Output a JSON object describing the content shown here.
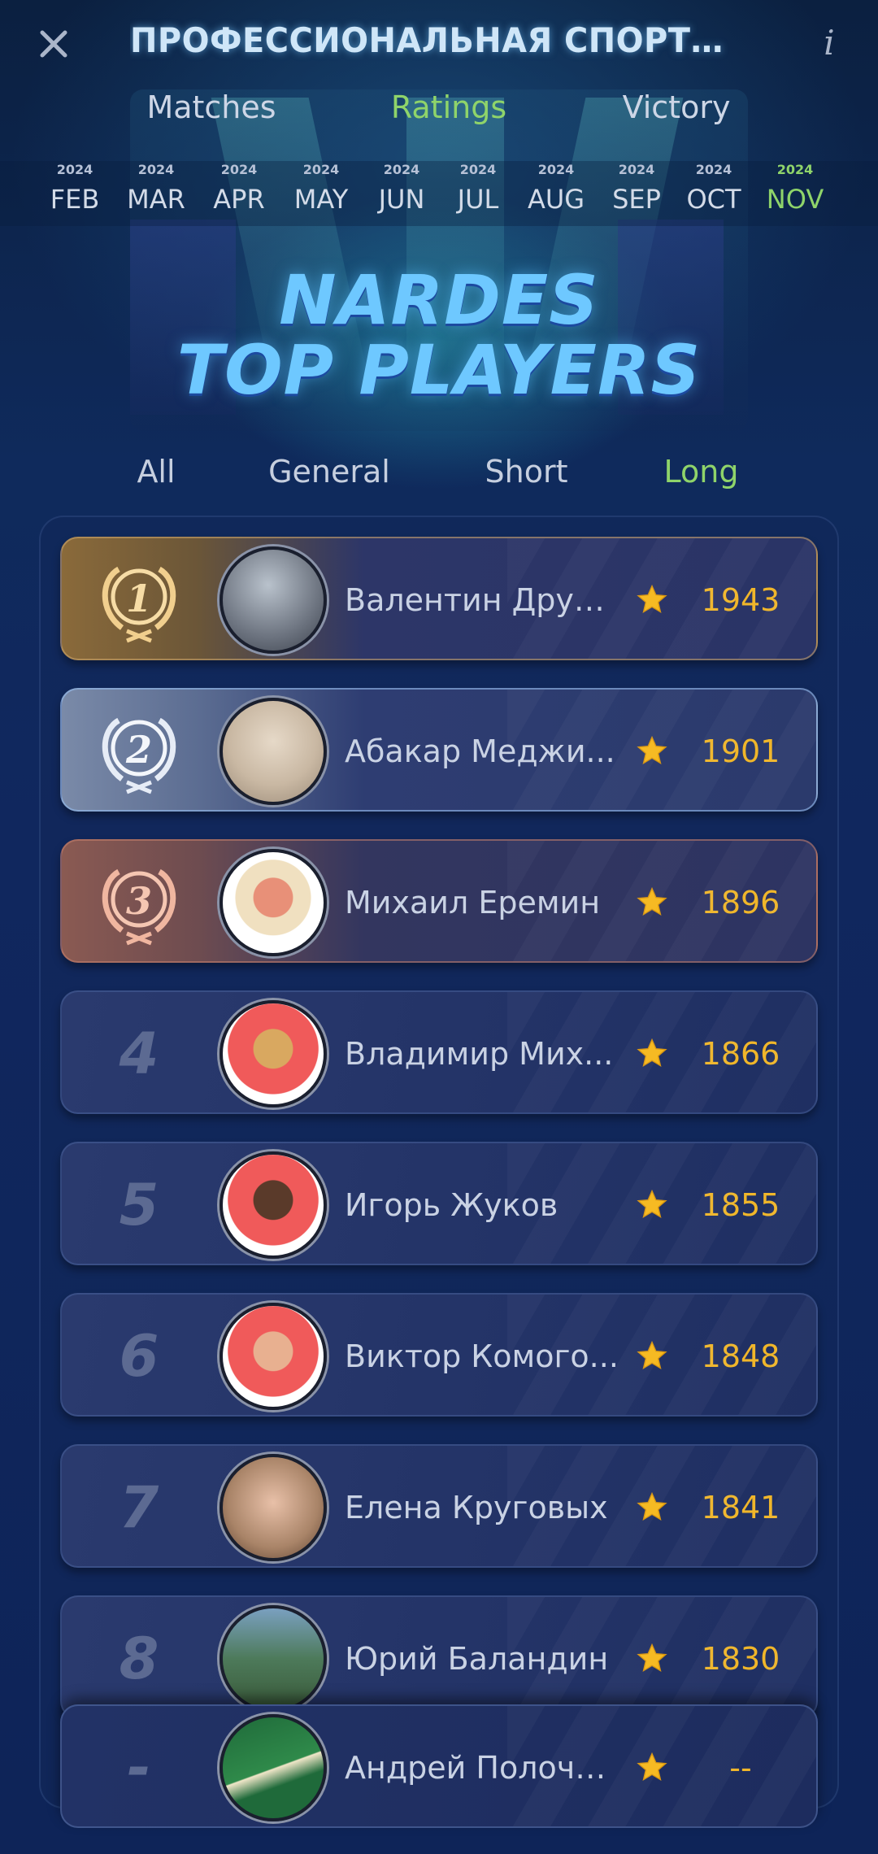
{
  "header": {
    "title": "ПРОФЕССИОНАЛЬНАЯ СПОРТИВНАЯ ...",
    "close_icon": "close-icon",
    "info_icon": "info-icon"
  },
  "tabs": [
    {
      "label": "Matches",
      "active": false
    },
    {
      "label": "Ratings",
      "active": true
    },
    {
      "label": "Victory",
      "active": false
    }
  ],
  "months": [
    {
      "year": "2024",
      "month": "FEB"
    },
    {
      "year": "2024",
      "month": "MAR"
    },
    {
      "year": "2024",
      "month": "APR"
    },
    {
      "year": "2024",
      "month": "MAY"
    },
    {
      "year": "2024",
      "month": "JUN"
    },
    {
      "year": "2024",
      "month": "JUL"
    },
    {
      "year": "2024",
      "month": "AUG"
    },
    {
      "year": "2024",
      "month": "SEP"
    },
    {
      "year": "2024",
      "month": "OCT"
    },
    {
      "year": "2024",
      "month": "NOV",
      "active": true
    }
  ],
  "logo": {
    "line1": "NARDES",
    "line2": "TOP PLAYERS"
  },
  "categories": [
    {
      "label": "All",
      "active": false
    },
    {
      "label": "General",
      "active": false
    },
    {
      "label": "Short",
      "active": false
    },
    {
      "label": "Long",
      "active": true
    }
  ],
  "players": [
    {
      "rank": "1",
      "name": "Валентин Друж...",
      "score": "1943"
    },
    {
      "rank": "2",
      "name": "Абакар Меджи...",
      "score": "1901"
    },
    {
      "rank": "3",
      "name": "Михаил Еремин",
      "score": "1896"
    },
    {
      "rank": "4",
      "name": "Владимир Мих...",
      "score": "1866"
    },
    {
      "rank": "5",
      "name": "Игорь Жуков",
      "score": "1855"
    },
    {
      "rank": "6",
      "name": "Виктор Комого...",
      "score": "1848"
    },
    {
      "rank": "7",
      "name": "Елена Круговых",
      "score": "1841"
    },
    {
      "rank": "8",
      "name": "Юрий Баландин",
      "score": "1830"
    }
  ],
  "current_user": {
    "rank": "-",
    "name": "Андрей Полочк...",
    "score": "--"
  },
  "colors": {
    "accent_green": "#8fd46a",
    "score_gold": "#f0b62a",
    "background": "#0d1f4a"
  }
}
